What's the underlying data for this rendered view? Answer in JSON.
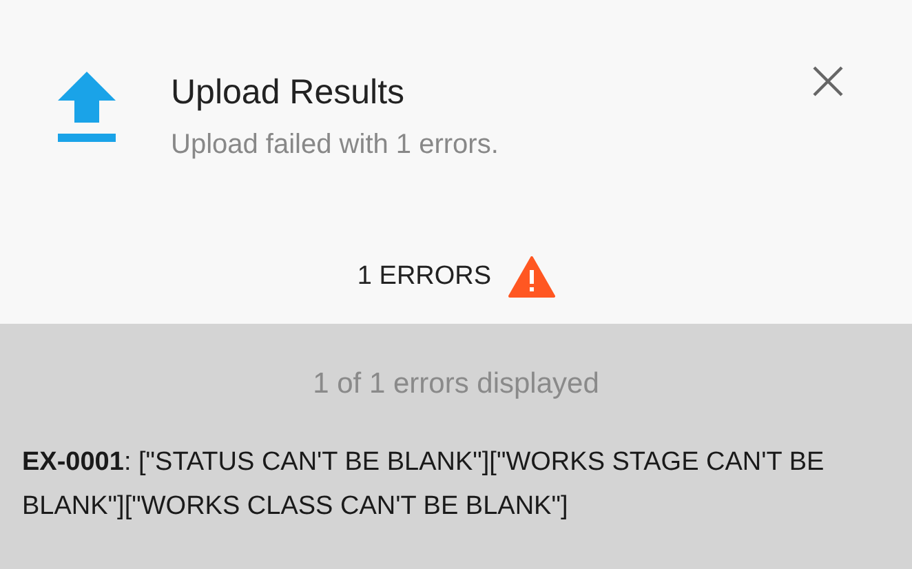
{
  "header": {
    "title": "Upload Results",
    "subtitle": "Upload failed with 1 errors."
  },
  "error_count": "1 ERRORS",
  "summary": "1 of 1 errors displayed",
  "errors": [
    "**EX-0001**: [\"STATUS CAN'T BE BLANK\"][\"WORKS STAGE CAN'T BE BLANK\"][\"WORKS CLASS CAN'T BE BLANK\"]"
  ]
}
